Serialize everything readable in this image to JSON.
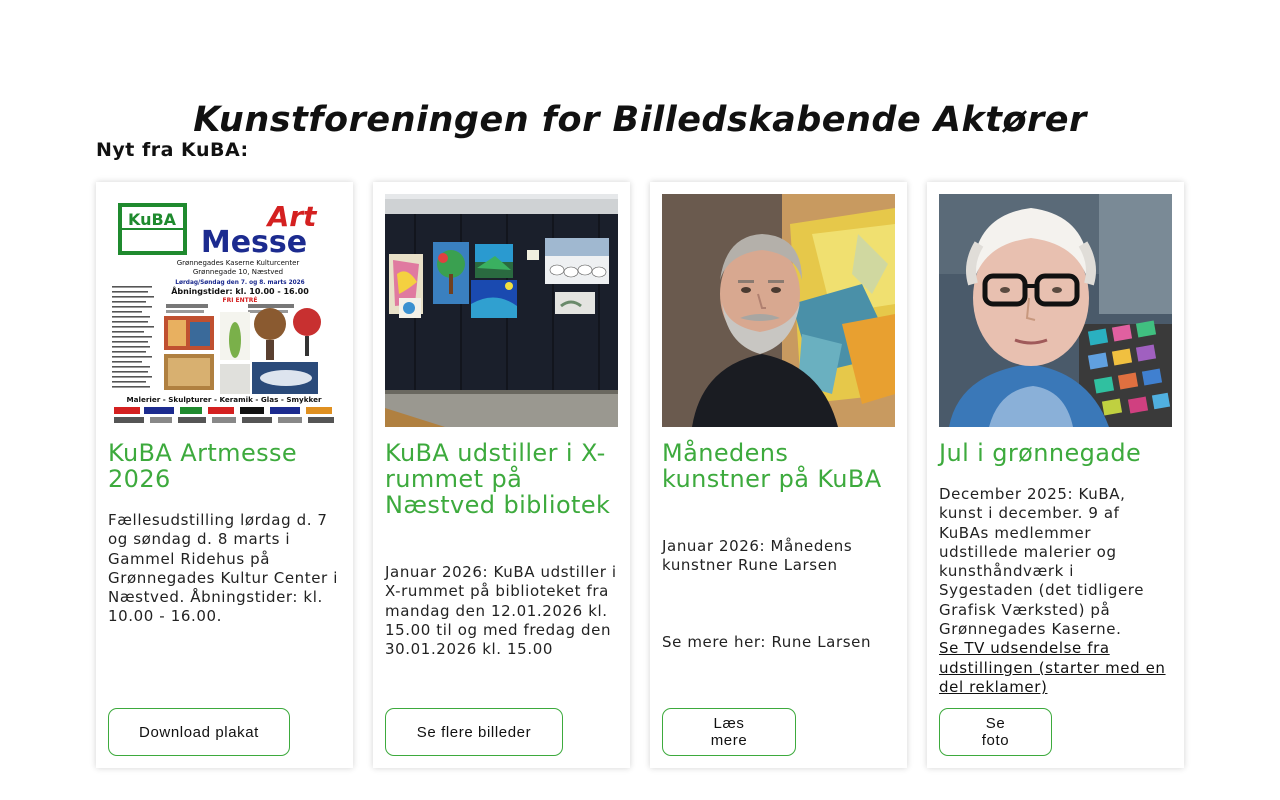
{
  "header": {
    "site_title": "Kunstforeningen for Billedskabende Aktører"
  },
  "news": {
    "title": "Nyt fra KuBA:",
    "cards": [
      {
        "title": "KuBA Artmesse 2026",
        "text": "Fællesudstilling lørdag d. 7 og søndag d. 8 marts i Gammel Ridehus på Grønnegades Kultur Center i Næstved. Åbningstider: kl. 10.00 - 16.00.",
        "button": "Download plakat",
        "poster": {
          "logo": "KuBA",
          "art": "Art",
          "messe": "Messe",
          "venue": "Grønnegades Kaserne Kulturcenter",
          "address": "Grønnegade 10, Næstved",
          "dates": "Lørdag/Søndag den 7. og 8. marts 2026",
          "hours": "Åbningstider: kl. 10.00 - 16.00",
          "entry": "FRI ENTRÉ",
          "categories": "Malerier - Skulpturer - Keramik - Glas - Smykker"
        }
      },
      {
        "title": "KuBA udstiller i X-rummet på Næstved bibliotek",
        "text": "Januar 2026: KuBA udstiller i X-rummet på biblioteket fra mandag den 12.01.2026  kl. 15.00 til og med fredag den 30.01.2026 kl. 15.00",
        "button": "Se flere billeder"
      },
      {
        "title": "Månedens kunstner på KuBA",
        "text": "Januar 2026: Månedens kunstner Rune Larsen",
        "text2": "Se mere her: Rune Larsen",
        "button": "Læs mere"
      },
      {
        "title": "Jul i grønnegade",
        "text": "December 2025: KuBA, kunst i december. 9 af KuBAs medlemmer udstillede malerier og kunsthåndværk i Sygestaden (det tidligere Grafisk Værksted) på Grønnegades Kaserne.",
        "link": "Se TV udsendelse fra udstillingen (starter med en del reklamer)",
        "button": "Se foto"
      }
    ]
  },
  "colors": {
    "accent": "#3daa3d",
    "text": "#222222",
    "background": "#ffffff"
  }
}
